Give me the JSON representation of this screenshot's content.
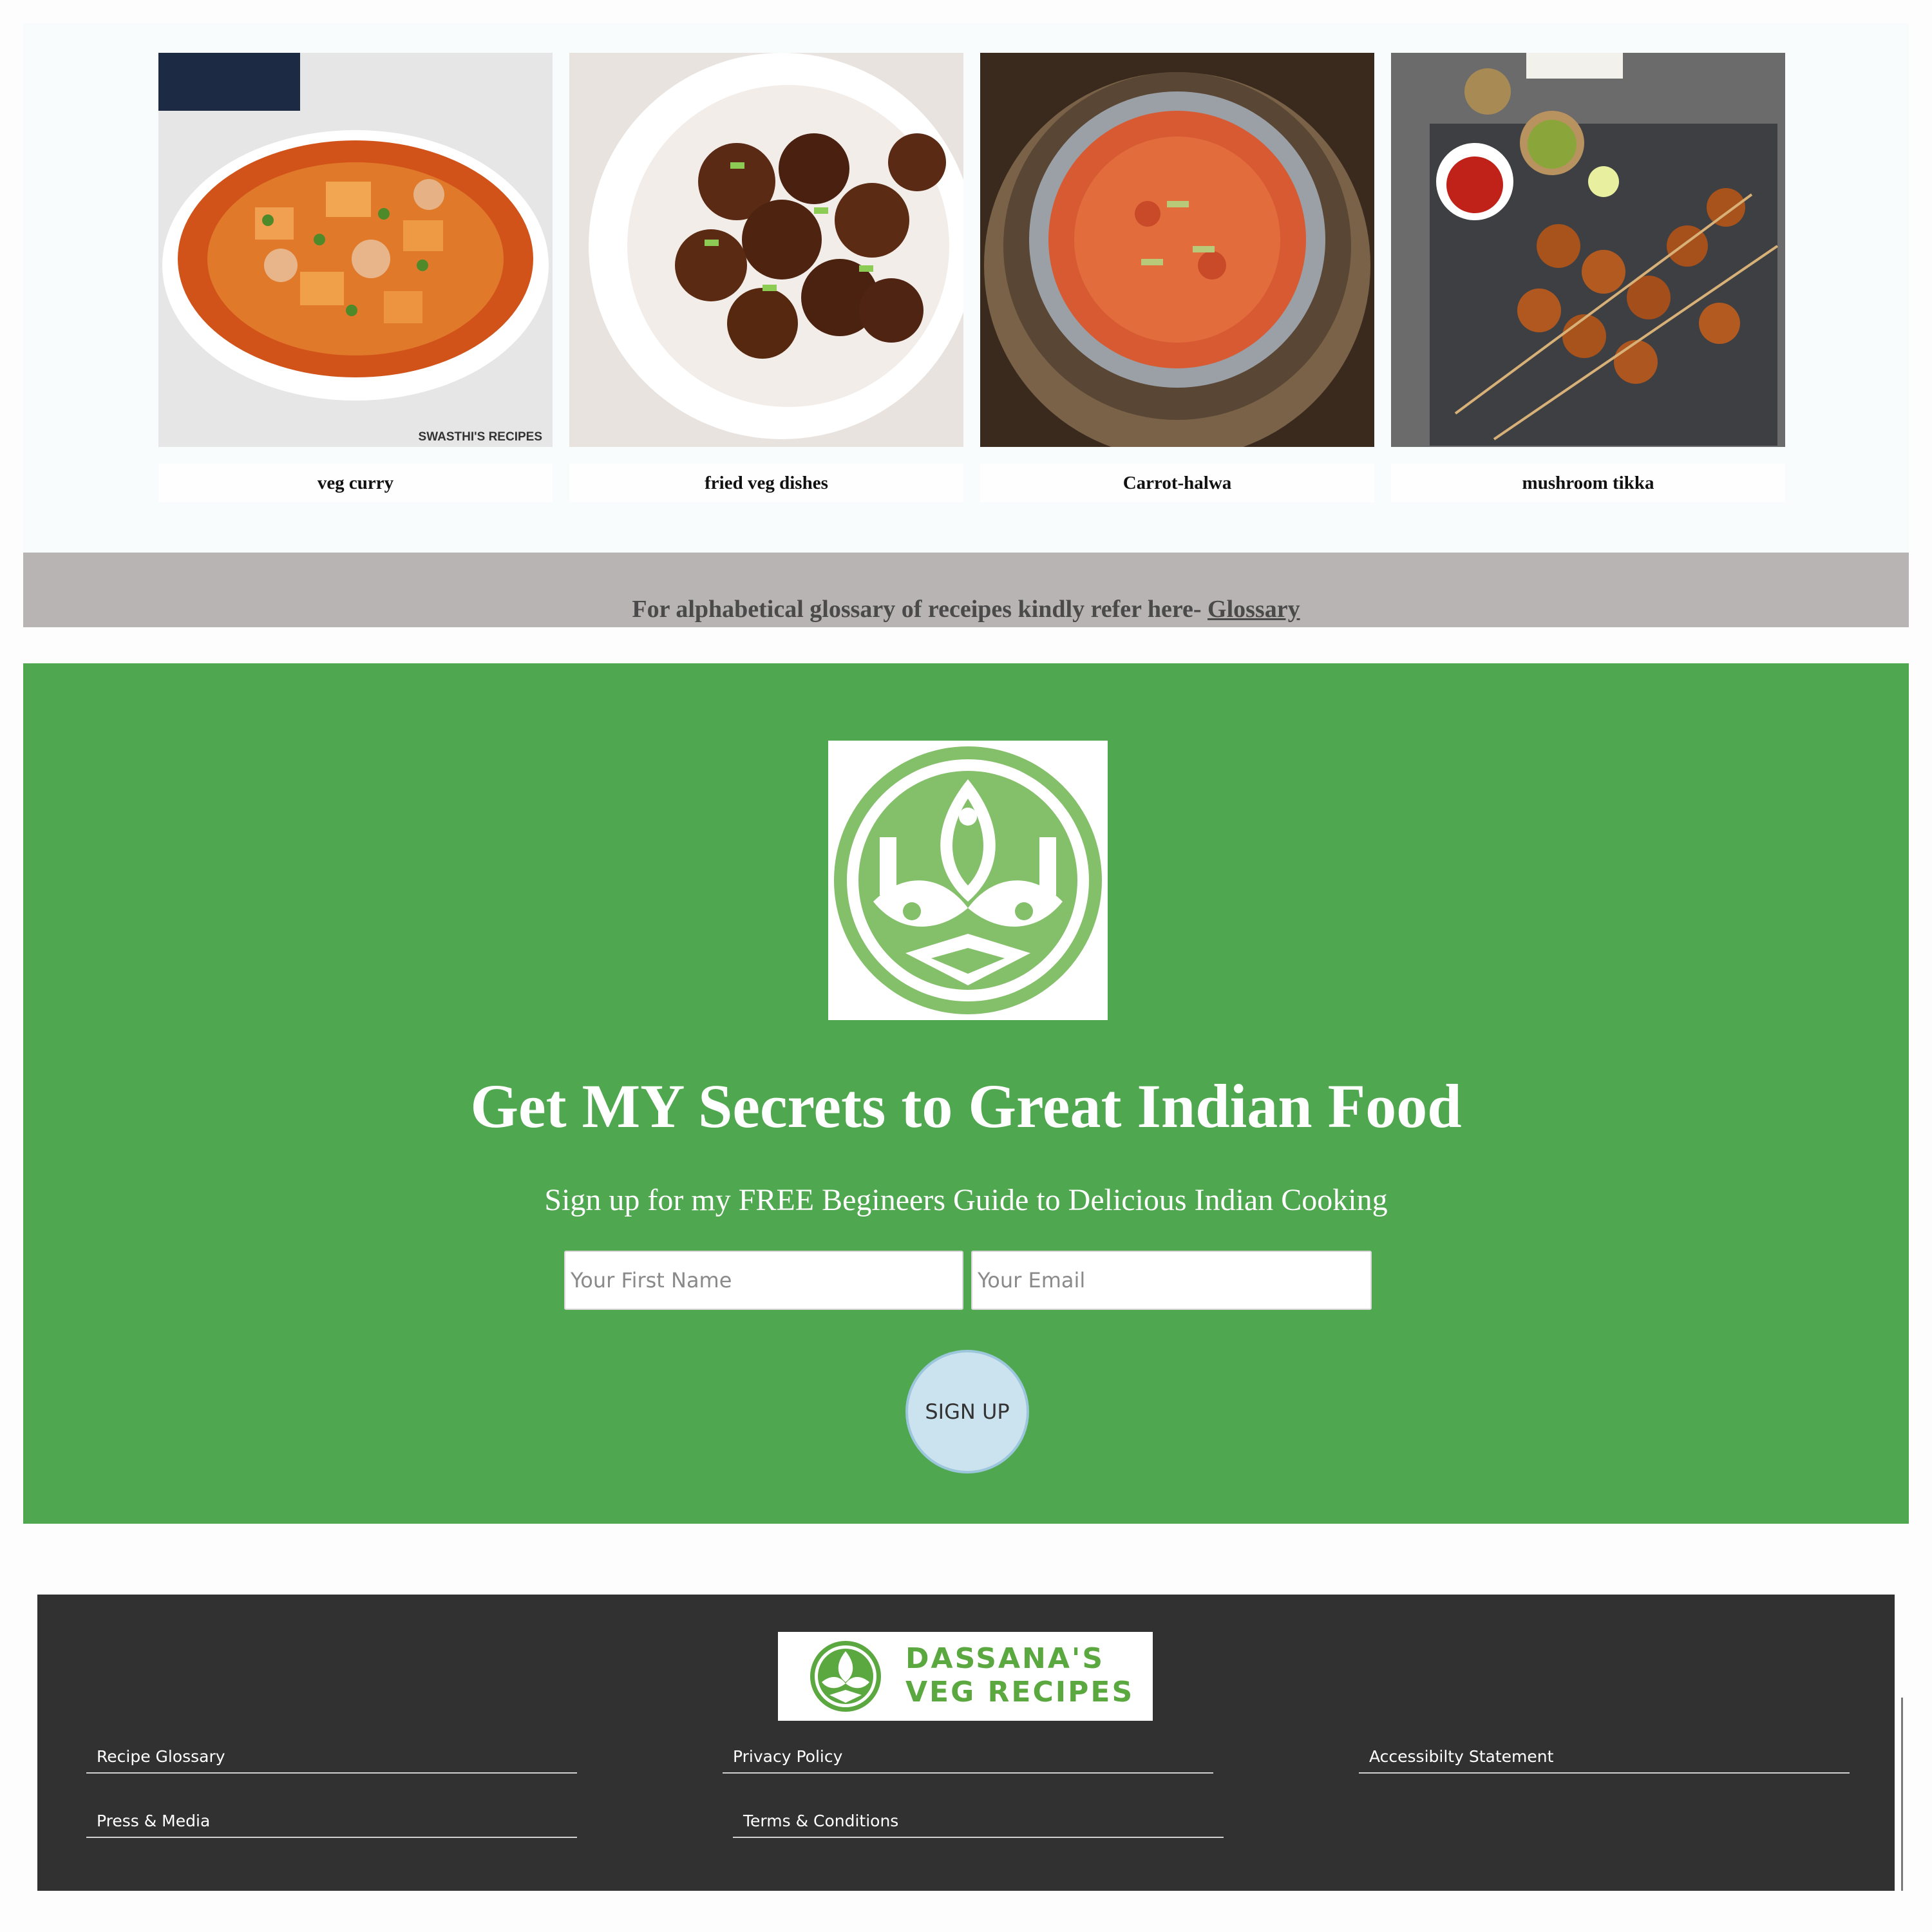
{
  "gallery": {
    "cards": [
      {
        "label": "veg curry",
        "image": "veg-curry-photo",
        "watermark": "SWASTHI'S RECIPES"
      },
      {
        "label": "fried veg dishes",
        "image": "fried-veg-photo"
      },
      {
        "label": "Carrot-halwa",
        "image": "carrot-halwa-photo"
      },
      {
        "label": "mushroom tikka",
        "image": "mushroom-tikka-photo"
      }
    ]
  },
  "glossary": {
    "text": "For alphabetical glossary of receipes kindly refer here- ",
    "link": "Glossary"
  },
  "signup": {
    "logo": "dassana-emblem-icon",
    "title": "Get MY Secrets to Great Indian Food",
    "subtitle": "Sign up for my FREE Begineers Guide to Delicious Indian Cooking",
    "first_name_placeholder": "Your First Name",
    "email_placeholder": "Your Email",
    "button": "SIGN UP"
  },
  "footer": {
    "logo_line1": "DASSANA'S",
    "logo_line2": "VEG RECIPES",
    "links": {
      "recipe_glossary": "Recipe Glossary",
      "privacy_policy": "Privacy Policy",
      "accessibility": "Accessibilty Statement",
      "press_media": "Press & Media",
      "terms": "Terms & Conditions"
    }
  },
  "colors": {
    "signup_bg": "#4fa84f",
    "glossary_bg": "#b8b4b4",
    "footer_bg": "#313131",
    "brand_green": "#5aa83f",
    "emblem_green": "#84bf6a",
    "button_bg": "#cbe3ee"
  }
}
